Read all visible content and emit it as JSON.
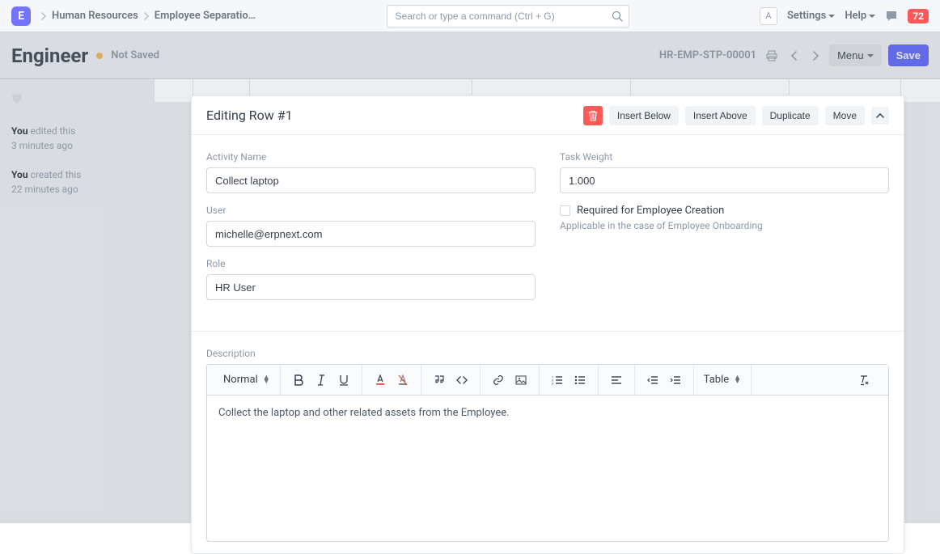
{
  "navbar": {
    "logo_letter": "E",
    "breadcrumb": [
      "Human Resources",
      "Employee Separatio…"
    ],
    "search_placeholder": "Search or type a command (Ctrl + G)",
    "avatar_letter": "A",
    "settings_label": "Settings",
    "help_label": "Help",
    "notification_count": "72"
  },
  "page": {
    "title": "Engineer",
    "status": "Not Saved",
    "doc_id": "HR-EMP-STP-00001",
    "menu_label": "Menu",
    "save_label": "Save"
  },
  "sidebar": {
    "timeline": [
      {
        "prefix": "You",
        "text": "edited this",
        "time": "3 minutes ago"
      },
      {
        "prefix": "You",
        "text": "created this",
        "time": "22 minutes ago"
      }
    ]
  },
  "modal": {
    "title": "Editing Row #1",
    "actions": {
      "insert_below": "Insert Below",
      "insert_above": "Insert Above",
      "duplicate": "Duplicate",
      "move": "Move"
    },
    "fields": {
      "activity_name_label": "Activity Name",
      "activity_name_value": "Collect laptop",
      "user_label": "User",
      "user_value": "michelle@erpnext.com",
      "role_label": "Role",
      "role_value": "HR User",
      "task_weight_label": "Task Weight",
      "task_weight_value": "1.000",
      "required_label": "Required for Employee Creation",
      "required_help": "Applicable in the case of Employee Onboarding",
      "description_label": "Description"
    },
    "editor": {
      "format_option": "Normal",
      "table_label": "Table",
      "content": "Collect the laptop and other related assets from the Employee."
    }
  }
}
